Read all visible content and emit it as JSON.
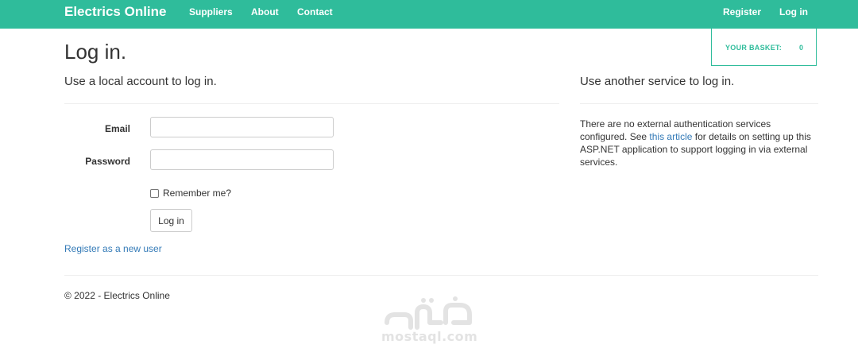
{
  "navbar": {
    "brand": "Electrics Online",
    "links": [
      "Suppliers",
      "About",
      "Contact"
    ],
    "right_links": [
      "Register",
      "Log in"
    ],
    "color": "#2fbc9b"
  },
  "basket": {
    "label": "YOUR BASKET:",
    "count": "0"
  },
  "main": {
    "title": "Log in.",
    "local_heading": "Use a local account to log in.",
    "email_label": "Email",
    "email_value": "",
    "password_label": "Password",
    "password_value": "",
    "remember_label": "Remember me?",
    "remember_checked": false,
    "login_button": "Log in",
    "register_link": "Register as a new user"
  },
  "external": {
    "heading": "Use another service to log in.",
    "text_before": "There are no external authentication services configured. See ",
    "link": "this article",
    "text_after": " for details on setting up this ASP.NET application to support logging in via external services."
  },
  "footer": {
    "text": "© 2022 - Electrics Online"
  },
  "watermark": {
    "text": "mostaql.com",
    "logo_icon": "mostaql-logo"
  },
  "colors": {
    "accent": "#2fbc9b",
    "link": "#337ab7",
    "text": "#333333"
  }
}
